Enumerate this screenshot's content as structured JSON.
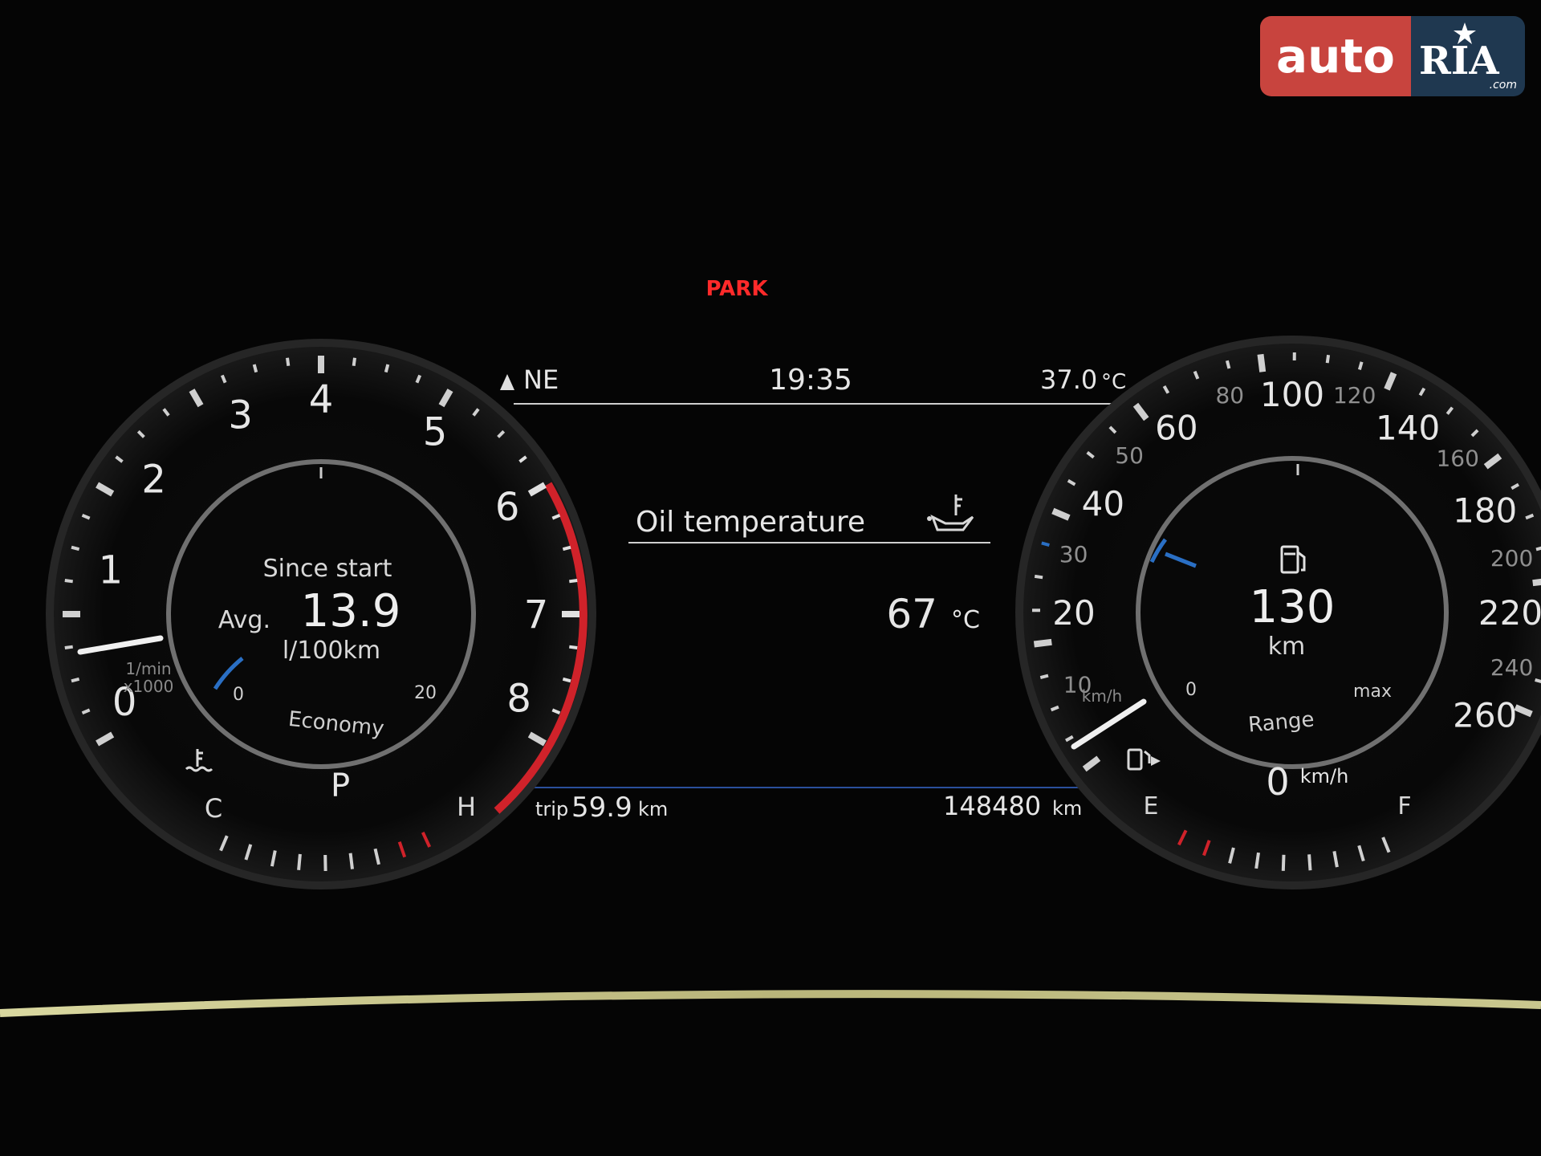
{
  "watermark": {
    "part1": "auto",
    "part2": "RIA",
    "part3": ".com"
  },
  "park_indicator": "PARK",
  "top_bar": {
    "heading": "NE",
    "time": "19:35",
    "outside_temp": "37.0",
    "temp_unit": "°C"
  },
  "center_display": {
    "title": "Oil temperature",
    "value": "67",
    "unit": "°C"
  },
  "bottom_bar": {
    "trip_label": "trip",
    "trip_value": "59.9",
    "trip_unit": "km",
    "odometer_value": "148480",
    "odometer_unit": "km"
  },
  "tachometer": {
    "scale_labels": [
      "0",
      "1",
      "2",
      "3",
      "4",
      "5",
      "6",
      "7",
      "8"
    ],
    "unit_line1": "1/min",
    "unit_line2": "x1000",
    "needle_value": 0.95,
    "gear": "P",
    "coolant_cold": "C",
    "coolant_hot": "H",
    "inner_title": "Since start",
    "inner_prefix": "Avg.",
    "inner_value": "13.9",
    "inner_unit": "l/100km",
    "inner_scale_min": "0",
    "inner_scale_max": "20",
    "inner_mode": "Economy"
  },
  "speedometer": {
    "major_labels": [
      "0",
      "20",
      "40",
      "60",
      "100",
      "140",
      "180",
      "220",
      "260"
    ],
    "minor_labels": [
      "10",
      "30",
      "50",
      "80",
      "120",
      "160",
      "200",
      "240"
    ],
    "unit": "km/h",
    "unit_small": "km/h",
    "speed": "0",
    "fuel_empty": "E",
    "fuel_full": "F",
    "inner_value": "130",
    "inner_unit": "km",
    "inner_scale_min": "0",
    "inner_scale_max": "max",
    "inner_label": "Range"
  },
  "colors": {
    "background": "#050505",
    "gauge_ring": "#3a3a3a",
    "text": "#e6e6e6",
    "redline": "#d0222a",
    "accent_blue": "#2a6fc4",
    "park_red": "#ff2a2a"
  }
}
